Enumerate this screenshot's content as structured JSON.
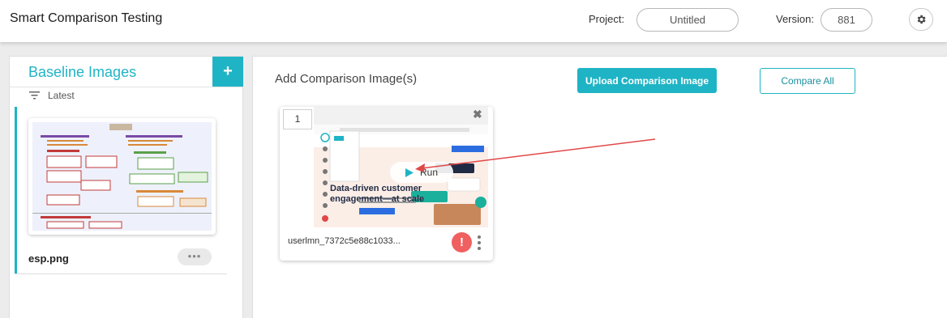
{
  "header": {
    "app_title": "Smart Comparison Testing",
    "project_label": "Project:",
    "project_value": "Untitled",
    "version_label": "Version:",
    "version_value": "881",
    "settings_icon": "gear-icon"
  },
  "left_panel": {
    "title": "Baseline Images",
    "add_icon": "plus-icon",
    "add_symbol": "+",
    "sort_icon": "filter-lines-icon",
    "sort_label": "Latest",
    "baseline_card": {
      "name": "esp.png",
      "more_label": "•••"
    }
  },
  "main_panel": {
    "title": "Add Comparison Image(s)",
    "upload_button": "Upload Comparison Image",
    "compare_all_button": "Compare All",
    "comparison_card": {
      "index": "1",
      "run_label": "Run",
      "name": "userlmn_7372c5e88c1033...",
      "error_symbol": "!",
      "thumb_headline_1": "Data-driven customer",
      "thumb_headline_2": "engagement—at scale"
    }
  },
  "colors": {
    "accent": "#1fb4c5",
    "error": "#f06060",
    "annotation_arrow": "#e04848"
  }
}
